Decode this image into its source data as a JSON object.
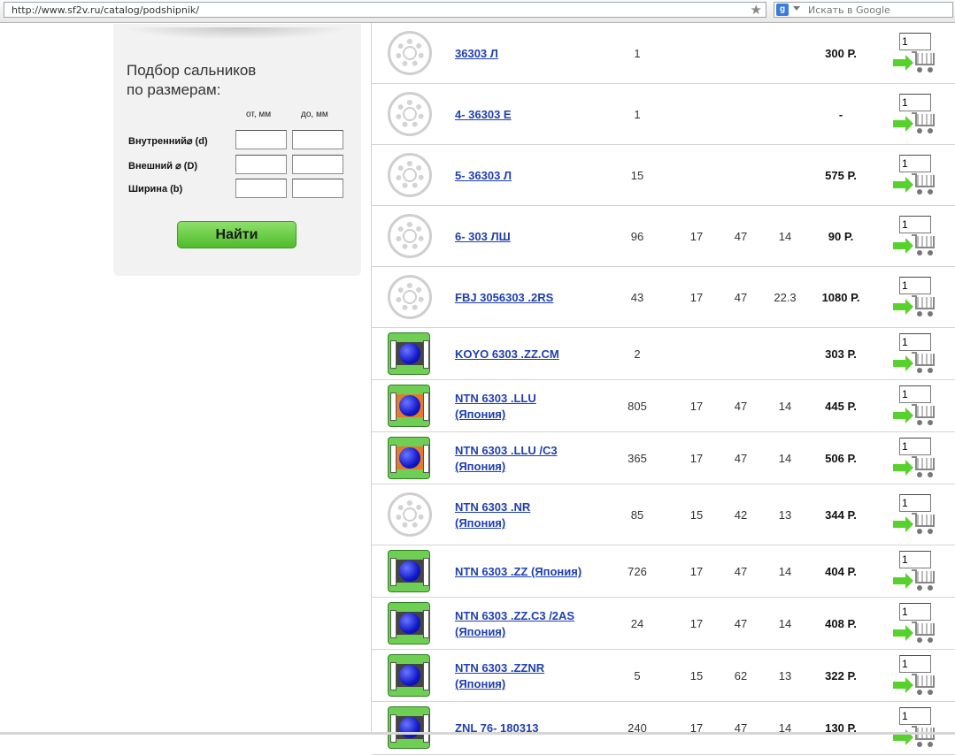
{
  "browser": {
    "url": "http://www.sf2v.ru/catalog/podshipnik/",
    "search_placeholder": "Искать в Google"
  },
  "filter": {
    "title_line1": "Подбор сальников",
    "title_line2": "по размерам:",
    "col_from": "от, мм",
    "col_to": "до, мм",
    "row_inner": "Внутренний⌀ (d)",
    "row_outer": "Внешний ⌀ (D)",
    "row_width": "Ширина (b)",
    "button": "Найти"
  },
  "products": [
    {
      "name": "36303 Л",
      "sub": "",
      "img": "ring",
      "qty": "1",
      "d": "",
      "D": "",
      "b": "",
      "price": "300 Р.",
      "cart_qty": "1"
    },
    {
      "name": "4- 36303 Е",
      "sub": "",
      "img": "ring",
      "qty": "1",
      "d": "",
      "D": "",
      "b": "",
      "price": "-",
      "cart_qty": "1"
    },
    {
      "name": "5- 36303 Л",
      "sub": "",
      "img": "ring",
      "qty": "15",
      "d": "",
      "D": "",
      "b": "",
      "price": "575 Р.",
      "cart_qty": "1"
    },
    {
      "name": "6- 303 ЛШ",
      "sub": "",
      "img": "ring",
      "qty": "96",
      "d": "17",
      "D": "47",
      "b": "14",
      "price": "90 Р.",
      "cart_qty": "1"
    },
    {
      "name": "FBJ 3056303 .2RS",
      "sub": "",
      "img": "ring",
      "qty": "43",
      "d": "17",
      "D": "47",
      "b": "22.3",
      "price": "1080 Р.",
      "cart_qty": "1"
    },
    {
      "name": "KOYO 6303 .ZZ.CM",
      "sub": "",
      "img": "seal-dark",
      "qty": "2",
      "d": "",
      "D": "",
      "b": "",
      "price": "303 Р.",
      "cart_qty": "1"
    },
    {
      "name": "NTN 6303 .LLU",
      "sub": "(Япония)",
      "img": "seal-orange",
      "qty": "805",
      "d": "17",
      "D": "47",
      "b": "14",
      "price": "445 Р.",
      "cart_qty": "1"
    },
    {
      "name": "NTN 6303 .LLU /C3",
      "sub": "(Япония)",
      "img": "seal-orange",
      "qty": "365",
      "d": "17",
      "D": "47",
      "b": "14",
      "price": "506 Р.",
      "cart_qty": "1"
    },
    {
      "name": "NTN 6303 .NR",
      "sub": "(Япония)",
      "img": "ring",
      "qty": "85",
      "d": "15",
      "D": "42",
      "b": "13",
      "price": "344 Р.",
      "cart_qty": "1"
    },
    {
      "name": "NTN 6303 .ZZ (Япония)",
      "sub": "",
      "img": "seal-dark",
      "qty": "726",
      "d": "17",
      "D": "47",
      "b": "14",
      "price": "404 Р.",
      "cart_qty": "1"
    },
    {
      "name": "NTN 6303 .ZZ.C3 /2AS",
      "sub": "(Япония)",
      "img": "seal-dark",
      "qty": "24",
      "d": "17",
      "D": "47",
      "b": "14",
      "price": "408 Р.",
      "cart_qty": "1"
    },
    {
      "name": "NTN 6303 .ZZNR",
      "sub": "(Япония)",
      "img": "seal-dark",
      "qty": "5",
      "d": "15",
      "D": "62",
      "b": "13",
      "price": "322 Р.",
      "cart_qty": "1"
    },
    {
      "name": "ZNL 76- 180313",
      "sub": "",
      "img": "seal-dark",
      "qty": "240",
      "d": "17",
      "D": "47",
      "b": "14",
      "price": "130 Р.",
      "cart_qty": "1"
    }
  ]
}
